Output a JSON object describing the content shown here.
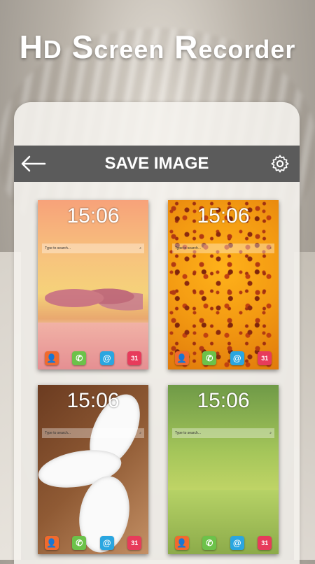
{
  "header": {
    "title_H": "H",
    "title_D": "D",
    "title_S": "S",
    "title_creen": "creen",
    "title_R": "R",
    "title_ecorder": "ecorder"
  },
  "toolbar": {
    "title": "SAVE IMAGE"
  },
  "wallpapers": [
    {
      "time": "15:06",
      "search_placeholder": "Type to search..."
    },
    {
      "time": "15:06",
      "search_placeholder": "Type to search..."
    },
    {
      "time": "15:06",
      "search_placeholder": "Type to search..."
    },
    {
      "time": "15:06",
      "search_placeholder": "Type to search..."
    }
  ],
  "dock": {
    "calendar_day": "31"
  },
  "colors": {
    "toolbar_bg": "#5b5b5b",
    "contact_app": "#f06a2e",
    "phone_app": "#6cc24a",
    "mail_app": "#2aa6e0",
    "calendar_app": "#e73b5b"
  },
  "icons": [
    "back-arrow-icon",
    "gear-icon",
    "search-icon",
    "contact-icon",
    "phone-icon",
    "mail-icon",
    "calendar-icon"
  ]
}
